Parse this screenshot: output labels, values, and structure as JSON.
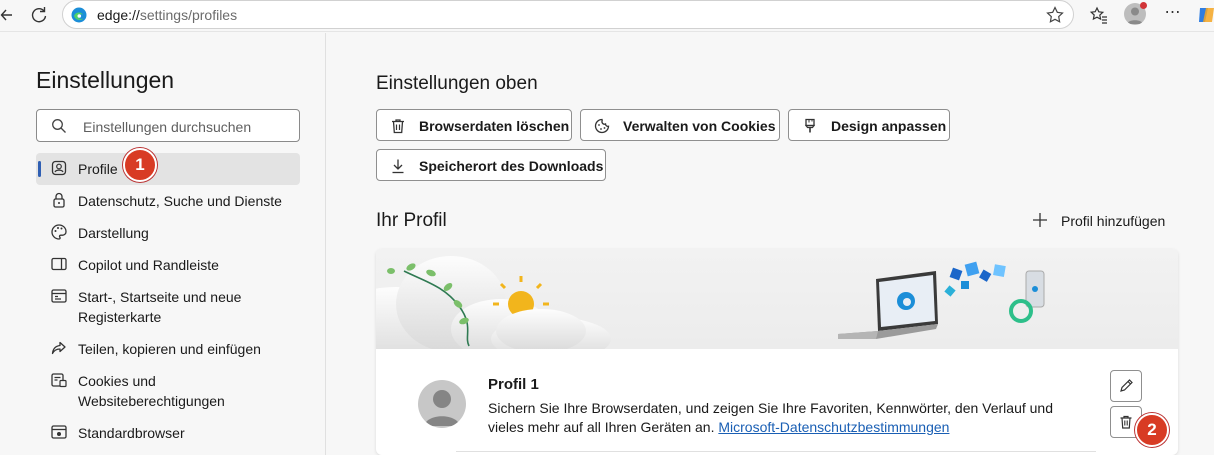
{
  "browser": {
    "address_host": "edge://",
    "address_path": "settings/profiles"
  },
  "sidebar": {
    "title": "Einstellungen",
    "search_placeholder": "Einstellungen durchsuchen",
    "items": [
      {
        "label": "Profile",
        "icon": "profile-icon",
        "active": true
      },
      {
        "label": "Datenschutz, Suche und Dienste",
        "icon": "lock-icon"
      },
      {
        "label": "Darstellung",
        "icon": "palette-icon"
      },
      {
        "label": "Copilot und Randleiste",
        "icon": "sidebar-icon"
      },
      {
        "label": "Start-, Startseite und neue Registerkarte",
        "icon": "home-tab-icon"
      },
      {
        "label": "Teilen, kopieren und einfügen",
        "icon": "share-icon"
      },
      {
        "label": "Cookies und Websiteberechtigungen",
        "icon": "cookie-permissions-icon"
      },
      {
        "label": "Standardbrowser",
        "icon": "browser-icon"
      }
    ]
  },
  "main": {
    "top_title": "Einstellungen oben",
    "quick_buttons": [
      {
        "label": "Browserdaten löschen",
        "icon": "trash-icon"
      },
      {
        "label": "Verwalten von Cookies",
        "icon": "cookie-icon"
      },
      {
        "label": "Design anpassen",
        "icon": "brush-icon"
      },
      {
        "label": "Speicherort des Downloads",
        "icon": "download-icon"
      }
    ],
    "profile_heading": "Ihr Profil",
    "add_profile_label": "Profil hinzufügen",
    "profile": {
      "name": "Profil 1",
      "description": "Sichern Sie Ihre Browserdaten, und zeigen Sie Ihre Favoriten, Kennwörter, den Verlauf und vieles mehr auf all Ihren Geräten an.",
      "link": "Microsoft-Datenschutzbestimmungen"
    }
  },
  "annotations": {
    "badge_1": "1",
    "badge_2": "2"
  },
  "colors": {
    "accent": "#2f5fb3",
    "badge": "#d83b24",
    "link": "#1a5fb4"
  }
}
